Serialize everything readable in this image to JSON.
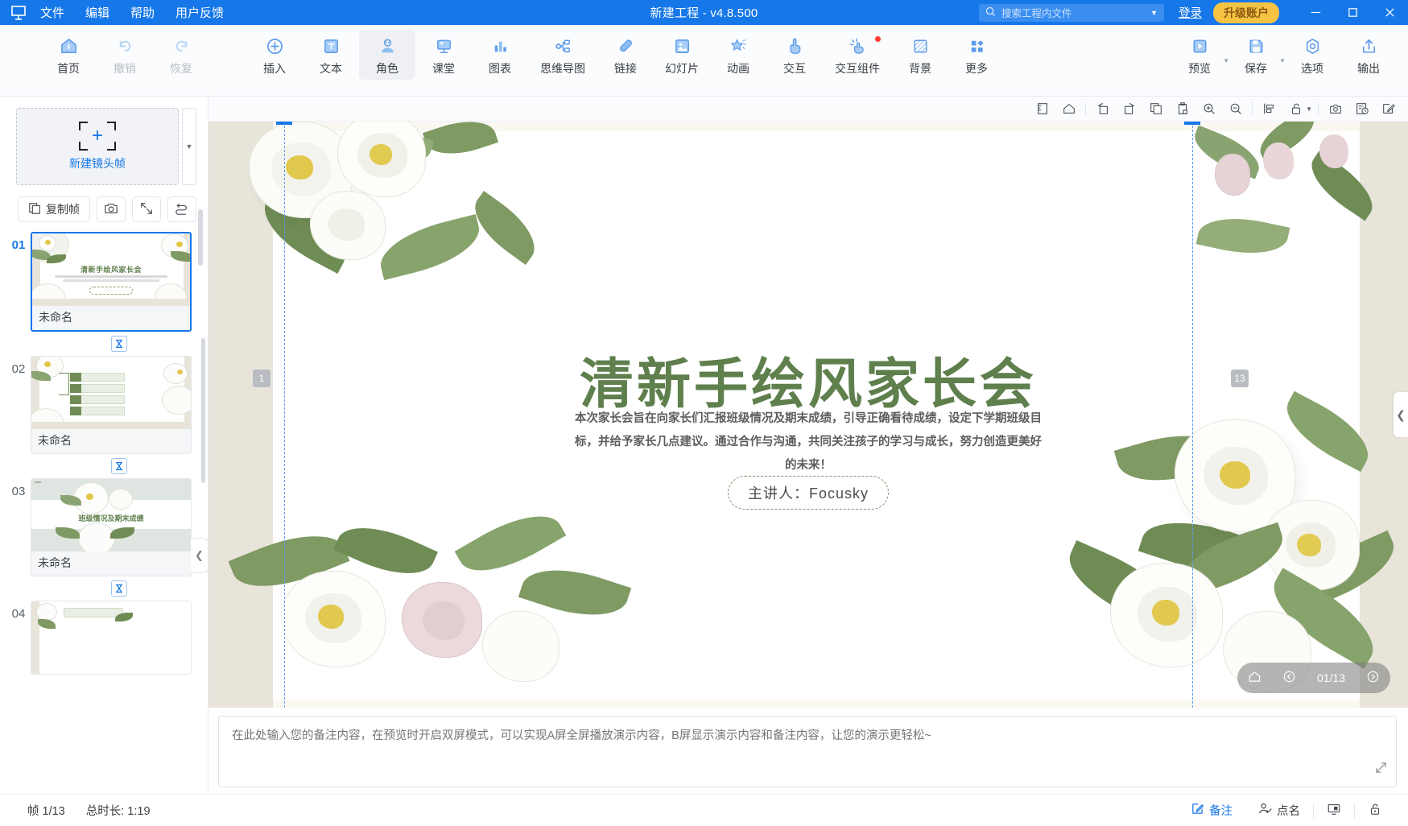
{
  "titlebar": {
    "logo_icon": "focusky-logo-icon",
    "menus": [
      "文件",
      "编辑",
      "帮助",
      "用户反馈"
    ],
    "title": "新建工程 - v4.8.500",
    "search": {
      "placeholder": "搜索工程内文件",
      "icon": "search-icon",
      "caret_icon": "chevron-down-icon"
    },
    "login_label": "登录",
    "upgrade_label": "升级账户",
    "window_buttons": [
      "minimize-icon",
      "maximize-icon",
      "close-icon"
    ]
  },
  "ribbon": {
    "groups": [
      {
        "items": [
          {
            "label": "首页",
            "icon": "home-icon",
            "state": "normal"
          },
          {
            "label": "撤销",
            "icon": "undo-icon",
            "state": "disabled"
          },
          {
            "label": "恢复",
            "icon": "redo-icon",
            "state": "disabled"
          }
        ]
      },
      {
        "items": [
          {
            "label": "插入",
            "icon": "plus-circle-icon",
            "state": "normal"
          },
          {
            "label": "文本",
            "icon": "text-box-icon",
            "state": "normal"
          },
          {
            "label": "角色",
            "icon": "character-icon",
            "state": "active"
          },
          {
            "label": "课堂",
            "icon": "classroom-icon",
            "state": "normal"
          },
          {
            "label": "图表",
            "icon": "bar-chart-icon",
            "state": "normal"
          },
          {
            "label": "思维导图",
            "icon": "mindmap-icon",
            "state": "normal"
          },
          {
            "label": "链接",
            "icon": "link-icon",
            "state": "normal"
          },
          {
            "label": "幻灯片",
            "icon": "slide-image-icon",
            "state": "normal"
          },
          {
            "label": "动画",
            "icon": "star-animation-icon",
            "state": "normal"
          },
          {
            "label": "交互",
            "icon": "hand-tap-icon",
            "state": "normal"
          },
          {
            "label": "交互组件",
            "icon": "interactive-component-icon",
            "state": "normal",
            "badge": true
          },
          {
            "label": "背景",
            "icon": "background-icon",
            "state": "normal"
          },
          {
            "label": "更多",
            "icon": "more-grid-icon",
            "state": "normal"
          }
        ]
      },
      {
        "items": [
          {
            "label": "预览",
            "icon": "preview-play-icon",
            "state": "normal",
            "dropdown": true
          },
          {
            "label": "保存",
            "icon": "save-disk-icon",
            "state": "normal",
            "dropdown": true
          },
          {
            "label": "选项",
            "icon": "options-gear-icon",
            "state": "normal"
          },
          {
            "label": "输出",
            "icon": "export-upload-icon",
            "state": "normal"
          }
        ]
      }
    ]
  },
  "left_panel": {
    "new_frame": {
      "label": "新建镜头帧",
      "icon": "add-frame-icon",
      "caret_icon": "chevron-down-icon"
    },
    "tools": [
      {
        "label": "复制帧",
        "icon": "copy-frame-icon"
      },
      {
        "label": "",
        "icon": "camera-icon"
      },
      {
        "label": "",
        "icon": "fit-frame-icon"
      },
      {
        "label": "",
        "icon": "reorder-path-icon"
      }
    ],
    "frames": [
      {
        "num": "01",
        "name": "未命名",
        "selected": true,
        "thumb": "title-slide"
      },
      {
        "num": "02",
        "name": "未命名",
        "selected": false,
        "thumb": "agenda-slide"
      },
      {
        "num": "03",
        "name": "未命名",
        "selected": false,
        "thumb": "section-slide"
      },
      {
        "num": "04",
        "name": "",
        "selected": false,
        "thumb": "content-slide"
      }
    ],
    "link_icon": "frame-transition-icon",
    "collapse_icon": "chevron-left-icon"
  },
  "canvas_toolbar": {
    "buttons": [
      {
        "icon": "ruler-icon"
      },
      {
        "icon": "home-shape-icon"
      },
      {
        "icon": "rotate-left-icon"
      },
      {
        "icon": "rotate-right-icon"
      },
      {
        "icon": "copy-icon"
      },
      {
        "icon": "paste-icon"
      },
      {
        "icon": "zoom-in-icon"
      },
      {
        "icon": "zoom-out-icon"
      },
      {
        "icon": "align-icon"
      },
      {
        "icon": "unlock-icon",
        "dropdown": true
      },
      {
        "icon": "snapshot-icon"
      },
      {
        "icon": "history-icon"
      },
      {
        "icon": "edit-icon"
      }
    ]
  },
  "slide": {
    "title": "清新手绘风家长会",
    "subtitle": "本次家长会旨在向家长们汇报班级情况及期末成绩，引导正确看待成绩，设定下学期班级目标，并给予家长几点建议。通过合作与沟通，共同关注孩子的学习与成长，努力创造更美好的未来！",
    "speaker": "主讲人：Focusky",
    "marker_start": "1",
    "marker_end": "13",
    "nav": {
      "counter": "01/13",
      "home_icon": "home-icon",
      "prev_icon": "prev-icon",
      "next_icon": "next-icon"
    },
    "side_arrow_icon": "chevron-left-icon",
    "colors": {
      "title_green": "#5f7f4d",
      "accent_blue": "#1677e8",
      "paper": "#ffffff",
      "band": "#e8e4da"
    }
  },
  "notes": {
    "placeholder": "在此处输入您的备注内容，在预览时开启双屏模式，可以实现A屏全屏播放演示内容，B屏显示演示内容和备注内容，让您的演示更轻松~",
    "value": "",
    "resize_icon": "resize-handle-icon"
  },
  "statusbar": {
    "frame_count": "帧 1/13",
    "duration": "总时长: 1:19",
    "items": [
      {
        "label": "备注",
        "icon": "notes-icon",
        "accent": true
      },
      {
        "label": "点名",
        "icon": "roll-call-icon",
        "accent": false
      },
      {
        "label": "",
        "icon": "presenter-screen-icon",
        "accent": false
      },
      {
        "label": "",
        "icon": "lock-icon",
        "accent": false
      }
    ]
  }
}
